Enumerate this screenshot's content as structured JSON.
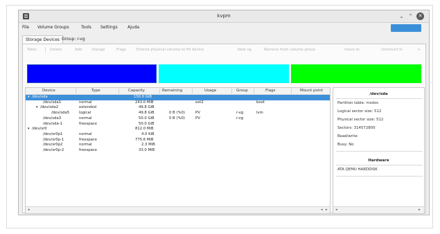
{
  "window": {
    "title": "kvpm"
  },
  "menu": [
    "File",
    "Volume Groups",
    "Tools",
    "Settings",
    "Ajuda"
  ],
  "tabs": [
    "Storage Devices",
    "Group: r-vg"
  ],
  "toolbar": [
    "Table",
    "Delete",
    "Add",
    "change",
    "Flags",
    "Extend physical volume to fill device",
    "New vg",
    "Remove from volume group",
    "move to",
    "Unmount fs"
  ],
  "colors": {
    "bar1": "#0000ff",
    "bar2": "#00ffff",
    "bar3": "#00ff00",
    "selection": "#3d8fd8",
    "accent": "#3b8fd9"
  },
  "columns": [
    "Device",
    "Type",
    "Capacity",
    "Remaining",
    "Usage",
    "Group",
    "Flags",
    "Mount point"
  ],
  "rows": [
    {
      "expander": "▾",
      "device": "/dev/sda",
      "type": "",
      "capacity": "150.0 GiB",
      "remaining": "",
      "usage": "",
      "group": "",
      "flags": ""
    },
    {
      "expander": "",
      "device": "/dev/sda1",
      "type": "normal",
      "capacity": "243.0 MiB",
      "remaining": "",
      "usage": "ext2",
      "group": "",
      "flags": "boot"
    },
    {
      "expander": "▾",
      "device": "/dev/sda2",
      "type": "extended",
      "capacity": "49.8 GiB",
      "remaining": "",
      "usage": "",
      "group": "",
      "flags": ""
    },
    {
      "expander": "",
      "device": "/dev/sda5",
      "type": "logical",
      "capacity": "49.8 GiB",
      "remaining": "0 B (%0)",
      "usage": "PV",
      "group": "r-vg",
      "flags": "lvm"
    },
    {
      "expander": "",
      "device": "/dev/sda3",
      "type": "normal",
      "capacity": "50.0 GiB",
      "remaining": "0 B (%0)",
      "usage": "PV",
      "group": "r-vg",
      "flags": ""
    },
    {
      "expander": "",
      "device": "/dev/sda-1",
      "type": "freespace",
      "capacity": "50.0 GiB",
      "remaining": "",
      "usage": "",
      "group": "",
      "flags": ""
    },
    {
      "expander": "▾",
      "device": "/dev/sr0",
      "type": "",
      "capacity": "812.0 MiB",
      "remaining": "",
      "usage": "",
      "group": "",
      "flags": ""
    },
    {
      "expander": "",
      "device": "/dev/sr0p1",
      "type": "normal",
      "capacity": "4.0 KiB",
      "remaining": "",
      "usage": "",
      "group": "",
      "flags": ""
    },
    {
      "expander": "",
      "device": "/dev/sr0p-1",
      "type": "freespace",
      "capacity": "775.6 MiB",
      "remaining": "",
      "usage": "",
      "group": "",
      "flags": ""
    },
    {
      "expander": "",
      "device": "/dev/sr0p2",
      "type": "normal",
      "capacity": "2.3 MiB",
      "remaining": "",
      "usage": "",
      "group": "",
      "flags": ""
    },
    {
      "expander": "",
      "device": "/dev/sr0p-2",
      "type": "freespace",
      "capacity": "33.0 MiB",
      "remaining": "",
      "usage": "",
      "group": "",
      "flags": ""
    }
  ],
  "side": {
    "device_title": "/dev/sda",
    "device_info": [
      "Partition table: msdos",
      "Logical sector size: 512",
      "Physical sector size: 512",
      "Sectors: 314572800",
      "Read/write",
      "Busy: No"
    ],
    "hardware_title": "Hardware",
    "hardware_info": [
      "ATA QEMU HARDDISK"
    ]
  }
}
